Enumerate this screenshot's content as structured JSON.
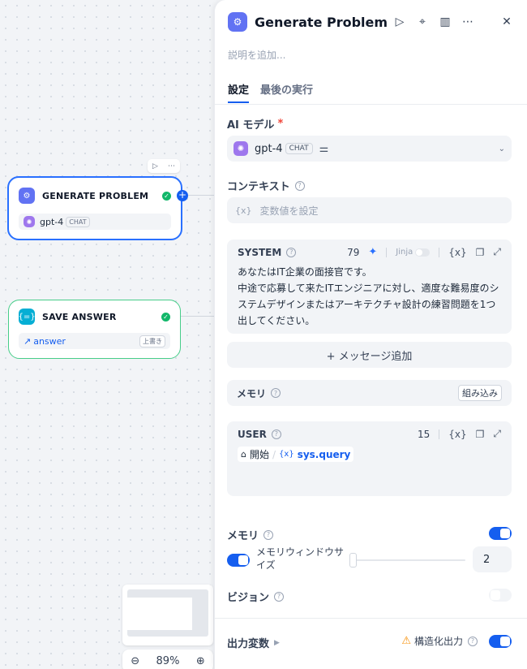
{
  "canvas": {
    "node_generate": {
      "title": "GENERATE PROBLEM",
      "model": "gpt-4",
      "mode_tag": "CHAT"
    },
    "node_save": {
      "title": "SAVE ANSWER",
      "var": "answer",
      "tag": "上書き"
    },
    "zoom": "89%"
  },
  "panel": {
    "title": "Generate Problem",
    "description_placeholder": "説明を追加...",
    "tabs": [
      "設定",
      "最後の実行"
    ],
    "model_label": "AI モデル",
    "required_mark": "*",
    "model_name": "gpt-4",
    "model_mode": "CHAT",
    "context_label": "コンテキスト",
    "context_placeholder": "変数値を設定",
    "context_var_icon": "{x}",
    "system": {
      "label": "SYSTEM",
      "count": "79",
      "jinja": "Jinja",
      "text": "あなたはIT企業の面接官です。\n中途で応募して来たITエンジニアに対し、適度な難易度のシステムデザインまたはアーキテクチャ設計の練習問題を1つ出してください。"
    },
    "add_message": "+ メッセージ追加",
    "memory_row": {
      "label": "メモリ",
      "badge": "組み込み"
    },
    "user": {
      "label": "USER",
      "count": "15",
      "var_node": "開始",
      "var_sep": "/",
      "var_icon": "{x}",
      "var_name": "sys.query"
    },
    "memory": {
      "label": "メモリ",
      "enabled": true,
      "window_label": "メモリウィンドウサイズ",
      "window_enabled": true,
      "window_value": "2"
    },
    "vision": {
      "label": "ビジョン",
      "enabled": false
    },
    "output": {
      "label": "出力変数",
      "structured_label": "構造化出力",
      "structured_enabled": true
    }
  },
  "colors": {
    "accent": "#155eef",
    "success": "#12b76a",
    "node_icon": "#6172f3",
    "model_icon": "#9e77ed",
    "warning": "#f79009"
  }
}
